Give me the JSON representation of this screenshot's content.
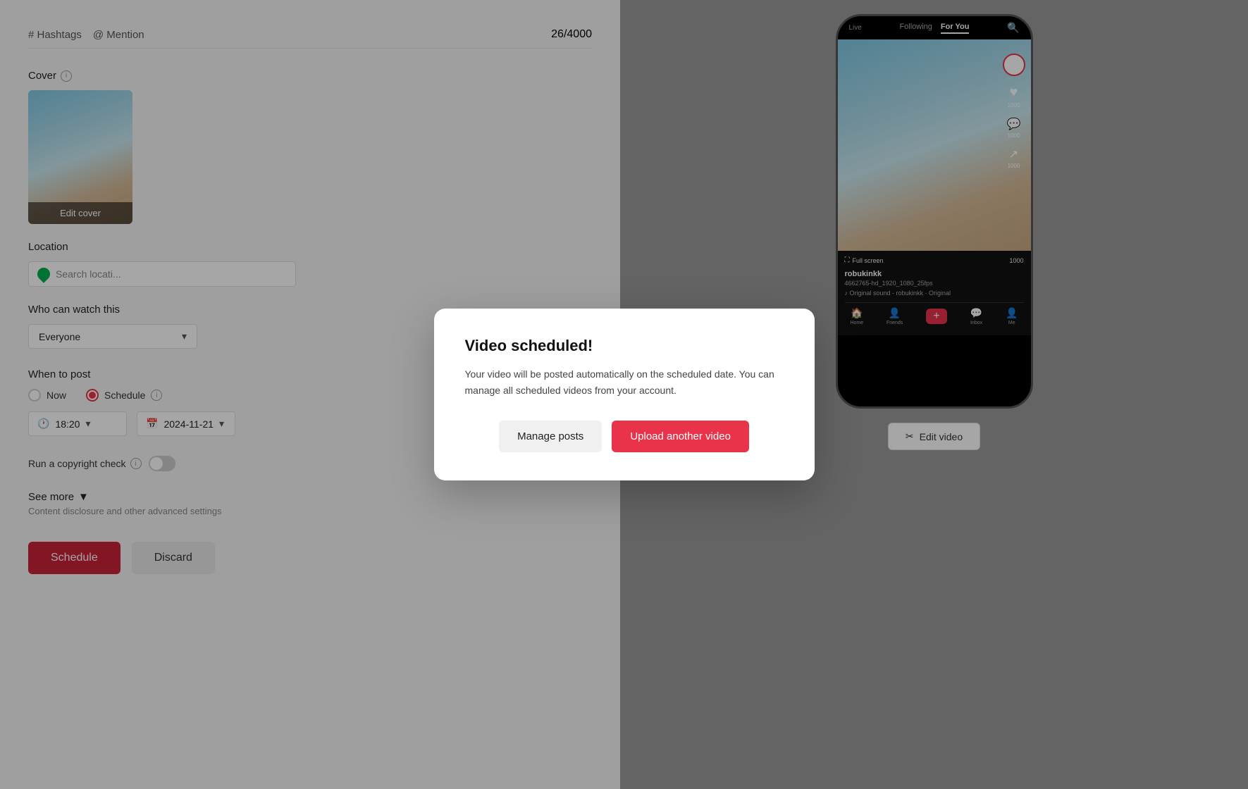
{
  "form": {
    "hashtags_label": "# Hashtags",
    "mention_label": "@ Mention",
    "char_count": "26/4000",
    "cover_label": "Cover",
    "edit_cover_label": "Edit cover",
    "location_label": "Location",
    "location_placeholder": "Search locati...",
    "who_label": "Who can watch this",
    "who_value": "Everyone",
    "when_label": "When to post",
    "radio_now": "Now",
    "radio_schedule": "Schedule",
    "time_value": "18:20",
    "date_value": "2024-11-21",
    "copyright_label": "Run a copyright check",
    "see_more_label": "See more",
    "see_more_sub": "Content disclosure and other advanced settings",
    "schedule_btn": "Schedule",
    "discard_btn": "Discard"
  },
  "phone": {
    "tab_live": "Live",
    "tab_following": "Following",
    "tab_foryou": "For You",
    "username": "robukinkk",
    "filename": "4662765-hd_1920_1080_25fps",
    "sound": "♪  Original sound - robukinkk · Original",
    "fullscreen": "Full screen",
    "nav_home": "Home",
    "nav_friends": "Friends",
    "nav_inbox": "Inbox",
    "nav_me": "Me",
    "heart_count": "1000",
    "comment_count": "1000",
    "share_count": "1000",
    "save_count": "1000",
    "edit_video_label": "Edit video"
  },
  "modal": {
    "title": "Video scheduled!",
    "body": "Your video will be posted automatically on the scheduled date. You can manage all scheduled videos from your account.",
    "manage_btn": "Manage posts",
    "upload_btn": "Upload another video"
  }
}
